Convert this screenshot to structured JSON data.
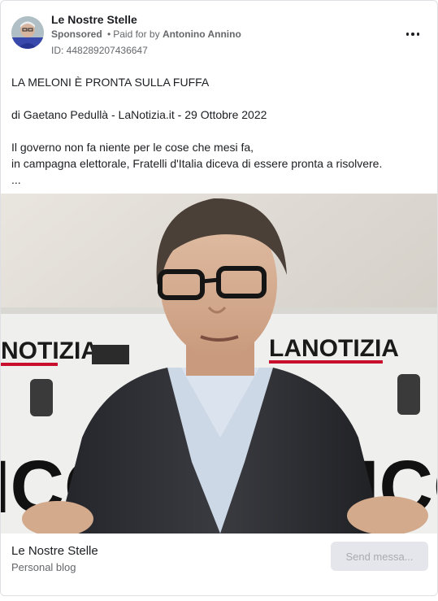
{
  "advertiser": {
    "name": "Le Nostre Stelle",
    "sponsored_label": "Sponsored",
    "separator": "•",
    "paid_for_prefix": "Paid for by",
    "payer": "Antonino Annino",
    "ad_id": "ID: 448289207436647"
  },
  "post": {
    "lines": [
      "LA MELONI È PRONTA SULLA FUFFA",
      "",
      "di Gaetano Pedullà - LaNotizia.it - 29 Ottobre 2022",
      "",
      "Il governo non fa niente per le cose che mesi fa,",
      "in campagna elettorale, Fratelli d'Italia diceva di essere pronta a risolvere.",
      "..."
    ]
  },
  "media": {
    "backdrop_text_left": "NOTIZIA",
    "backdrop_text_right": "LANOTIZIA",
    "backdrop_big_left": "ICO",
    "backdrop_big_right": "ICO"
  },
  "footer": {
    "title": "Le Nostre Stelle",
    "subtitle": "Personal blog",
    "cta_label": "Send messa..."
  },
  "colors": {
    "text_primary": "#1c1e21",
    "text_secondary": "#65676b",
    "cta_bg": "#e4e6eb",
    "cta_text": "#a8abaf",
    "brand_red": "#c8102e"
  }
}
